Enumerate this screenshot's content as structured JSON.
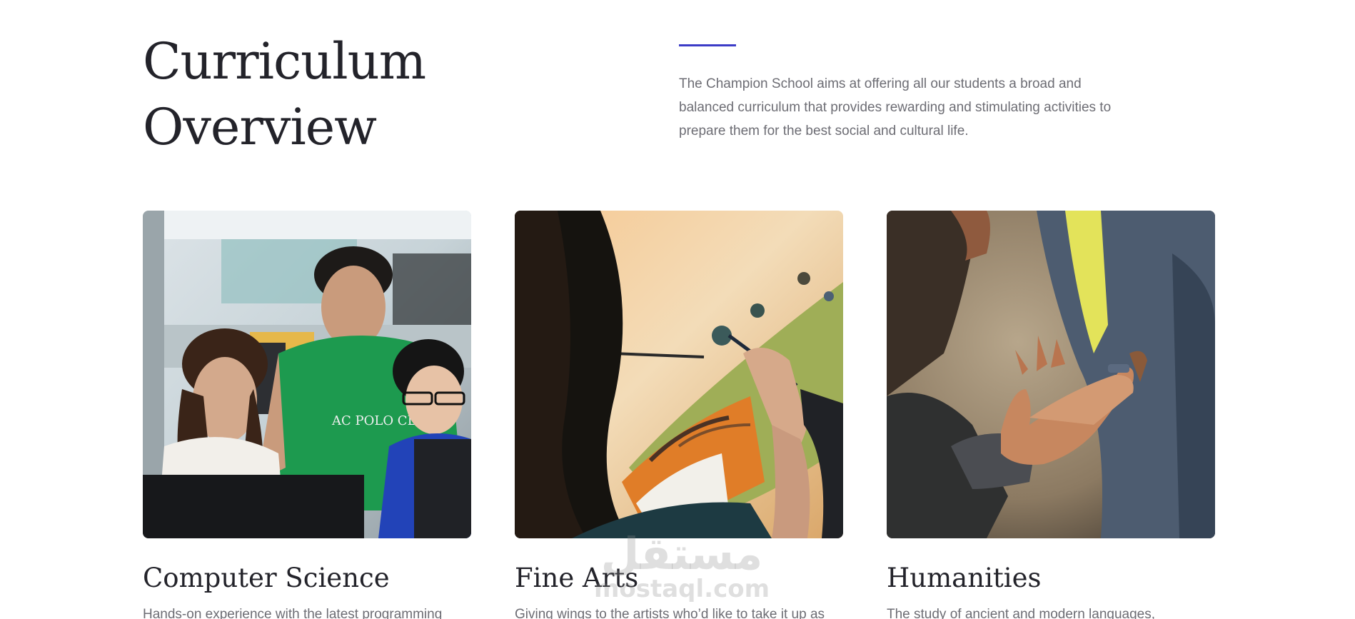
{
  "header": {
    "title": "Curriculum Overview",
    "intro": "The Champion School aims at offering all our students a broad and balanced curriculum that provides rewarding and stimulating activities to prepare them for the best social and cultural life.",
    "accent_color": "#3c3cc7"
  },
  "cards": [
    {
      "title": "Computer Science",
      "description": "Hands-on experience with the latest programming",
      "image": "students-at-computers-photo"
    },
    {
      "title": "Fine Arts",
      "description": "Giving wings to the artists who’d like to take it up as",
      "image": "painting-on-canvas-photo"
    },
    {
      "title": "Humanities",
      "description": "The study of ancient and modern languages,",
      "image": "hands-touching-photo"
    }
  ],
  "watermark": {
    "main": "مستقل",
    "sub": "mostaql.com"
  }
}
